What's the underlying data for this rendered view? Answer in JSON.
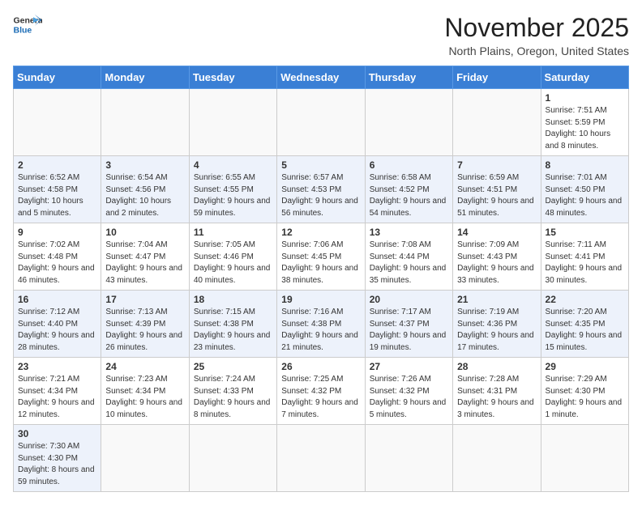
{
  "header": {
    "logo_general": "General",
    "logo_blue": "Blue",
    "month_title": "November 2025",
    "location": "North Plains, Oregon, United States"
  },
  "weekdays": [
    "Sunday",
    "Monday",
    "Tuesday",
    "Wednesday",
    "Thursday",
    "Friday",
    "Saturday"
  ],
  "weeks": [
    [
      {
        "day": "",
        "info": ""
      },
      {
        "day": "",
        "info": ""
      },
      {
        "day": "",
        "info": ""
      },
      {
        "day": "",
        "info": ""
      },
      {
        "day": "",
        "info": ""
      },
      {
        "day": "",
        "info": ""
      },
      {
        "day": "1",
        "info": "Sunrise: 7:51 AM\nSunset: 5:59 PM\nDaylight: 10 hours and 8 minutes."
      }
    ],
    [
      {
        "day": "2",
        "info": "Sunrise: 6:52 AM\nSunset: 4:58 PM\nDaylight: 10 hours and 5 minutes."
      },
      {
        "day": "3",
        "info": "Sunrise: 6:54 AM\nSunset: 4:56 PM\nDaylight: 10 hours and 2 minutes."
      },
      {
        "day": "4",
        "info": "Sunrise: 6:55 AM\nSunset: 4:55 PM\nDaylight: 9 hours and 59 minutes."
      },
      {
        "day": "5",
        "info": "Sunrise: 6:57 AM\nSunset: 4:53 PM\nDaylight: 9 hours and 56 minutes."
      },
      {
        "day": "6",
        "info": "Sunrise: 6:58 AM\nSunset: 4:52 PM\nDaylight: 9 hours and 54 minutes."
      },
      {
        "day": "7",
        "info": "Sunrise: 6:59 AM\nSunset: 4:51 PM\nDaylight: 9 hours and 51 minutes."
      },
      {
        "day": "8",
        "info": "Sunrise: 7:01 AM\nSunset: 4:50 PM\nDaylight: 9 hours and 48 minutes."
      }
    ],
    [
      {
        "day": "9",
        "info": "Sunrise: 7:02 AM\nSunset: 4:48 PM\nDaylight: 9 hours and 46 minutes."
      },
      {
        "day": "10",
        "info": "Sunrise: 7:04 AM\nSunset: 4:47 PM\nDaylight: 9 hours and 43 minutes."
      },
      {
        "day": "11",
        "info": "Sunrise: 7:05 AM\nSunset: 4:46 PM\nDaylight: 9 hours and 40 minutes."
      },
      {
        "day": "12",
        "info": "Sunrise: 7:06 AM\nSunset: 4:45 PM\nDaylight: 9 hours and 38 minutes."
      },
      {
        "day": "13",
        "info": "Sunrise: 7:08 AM\nSunset: 4:44 PM\nDaylight: 9 hours and 35 minutes."
      },
      {
        "day": "14",
        "info": "Sunrise: 7:09 AM\nSunset: 4:43 PM\nDaylight: 9 hours and 33 minutes."
      },
      {
        "day": "15",
        "info": "Sunrise: 7:11 AM\nSunset: 4:41 PM\nDaylight: 9 hours and 30 minutes."
      }
    ],
    [
      {
        "day": "16",
        "info": "Sunrise: 7:12 AM\nSunset: 4:40 PM\nDaylight: 9 hours and 28 minutes."
      },
      {
        "day": "17",
        "info": "Sunrise: 7:13 AM\nSunset: 4:39 PM\nDaylight: 9 hours and 26 minutes."
      },
      {
        "day": "18",
        "info": "Sunrise: 7:15 AM\nSunset: 4:38 PM\nDaylight: 9 hours and 23 minutes."
      },
      {
        "day": "19",
        "info": "Sunrise: 7:16 AM\nSunset: 4:38 PM\nDaylight: 9 hours and 21 minutes."
      },
      {
        "day": "20",
        "info": "Sunrise: 7:17 AM\nSunset: 4:37 PM\nDaylight: 9 hours and 19 minutes."
      },
      {
        "day": "21",
        "info": "Sunrise: 7:19 AM\nSunset: 4:36 PM\nDaylight: 9 hours and 17 minutes."
      },
      {
        "day": "22",
        "info": "Sunrise: 7:20 AM\nSunset: 4:35 PM\nDaylight: 9 hours and 15 minutes."
      }
    ],
    [
      {
        "day": "23",
        "info": "Sunrise: 7:21 AM\nSunset: 4:34 PM\nDaylight: 9 hours and 12 minutes."
      },
      {
        "day": "24",
        "info": "Sunrise: 7:23 AM\nSunset: 4:34 PM\nDaylight: 9 hours and 10 minutes."
      },
      {
        "day": "25",
        "info": "Sunrise: 7:24 AM\nSunset: 4:33 PM\nDaylight: 9 hours and 8 minutes."
      },
      {
        "day": "26",
        "info": "Sunrise: 7:25 AM\nSunset: 4:32 PM\nDaylight: 9 hours and 7 minutes."
      },
      {
        "day": "27",
        "info": "Sunrise: 7:26 AM\nSunset: 4:32 PM\nDaylight: 9 hours and 5 minutes."
      },
      {
        "day": "28",
        "info": "Sunrise: 7:28 AM\nSunset: 4:31 PM\nDaylight: 9 hours and 3 minutes."
      },
      {
        "day": "29",
        "info": "Sunrise: 7:29 AM\nSunset: 4:30 PM\nDaylight: 9 hours and 1 minute."
      }
    ],
    [
      {
        "day": "30",
        "info": "Sunrise: 7:30 AM\nSunset: 4:30 PM\nDaylight: 8 hours and 59 minutes."
      },
      {
        "day": "",
        "info": ""
      },
      {
        "day": "",
        "info": ""
      },
      {
        "day": "",
        "info": ""
      },
      {
        "day": "",
        "info": ""
      },
      {
        "day": "",
        "info": ""
      },
      {
        "day": "",
        "info": ""
      }
    ]
  ]
}
